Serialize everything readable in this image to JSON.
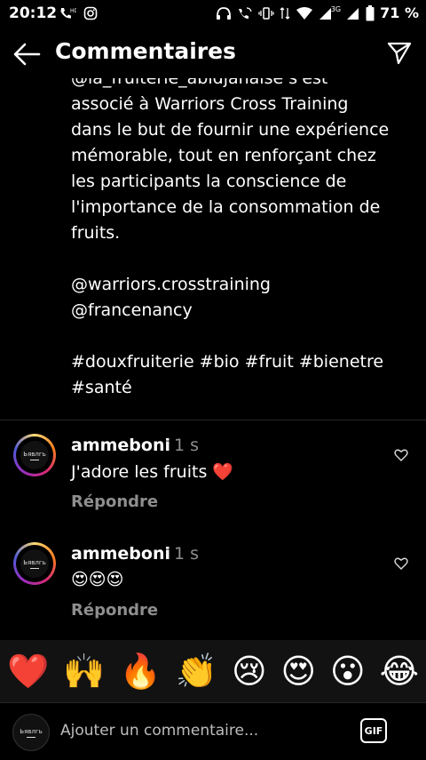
{
  "status_bar": {
    "time": "20:12",
    "battery_percent": "71 %",
    "network_label": "3G"
  },
  "header": {
    "title": "Commentaires"
  },
  "post_caption": "@la_fruiterie_abidjanaise s'est\nassocié à Warriors Cross Training\ndans le but de fournir une expérience\nmémorable, tout en renforçant chez\nles participants la conscience de\nl'importance de la consommation de\nfruits.\n\n@warriors.crosstraining\n@francenancy\n\n#douxfruiterie #bio #fruit #bienetre\n#santé",
  "comments": [
    {
      "username": "ammeboni",
      "time": "1 s",
      "text": "J'adore les fruits ❤️",
      "reply_label": "Répondre",
      "avatar_text": "Ьявлгь"
    },
    {
      "username": "ammeboni",
      "time": "1 s",
      "text": "😍😍😍",
      "reply_label": "Répondre",
      "avatar_text": "Ьявлгь"
    }
  ],
  "quick_emojis": [
    "❤️",
    "🙌",
    "🔥",
    "👏",
    "😢",
    "😍",
    "😮",
    "😂"
  ],
  "input": {
    "placeholder": "Ajouter un commentaire...",
    "gif_label": "GIF",
    "avatar_text": "Ьявлгь"
  },
  "colors": {
    "background": "#000000",
    "secondary_text": "#8e8e8e",
    "emoji_bar": "#121212"
  }
}
